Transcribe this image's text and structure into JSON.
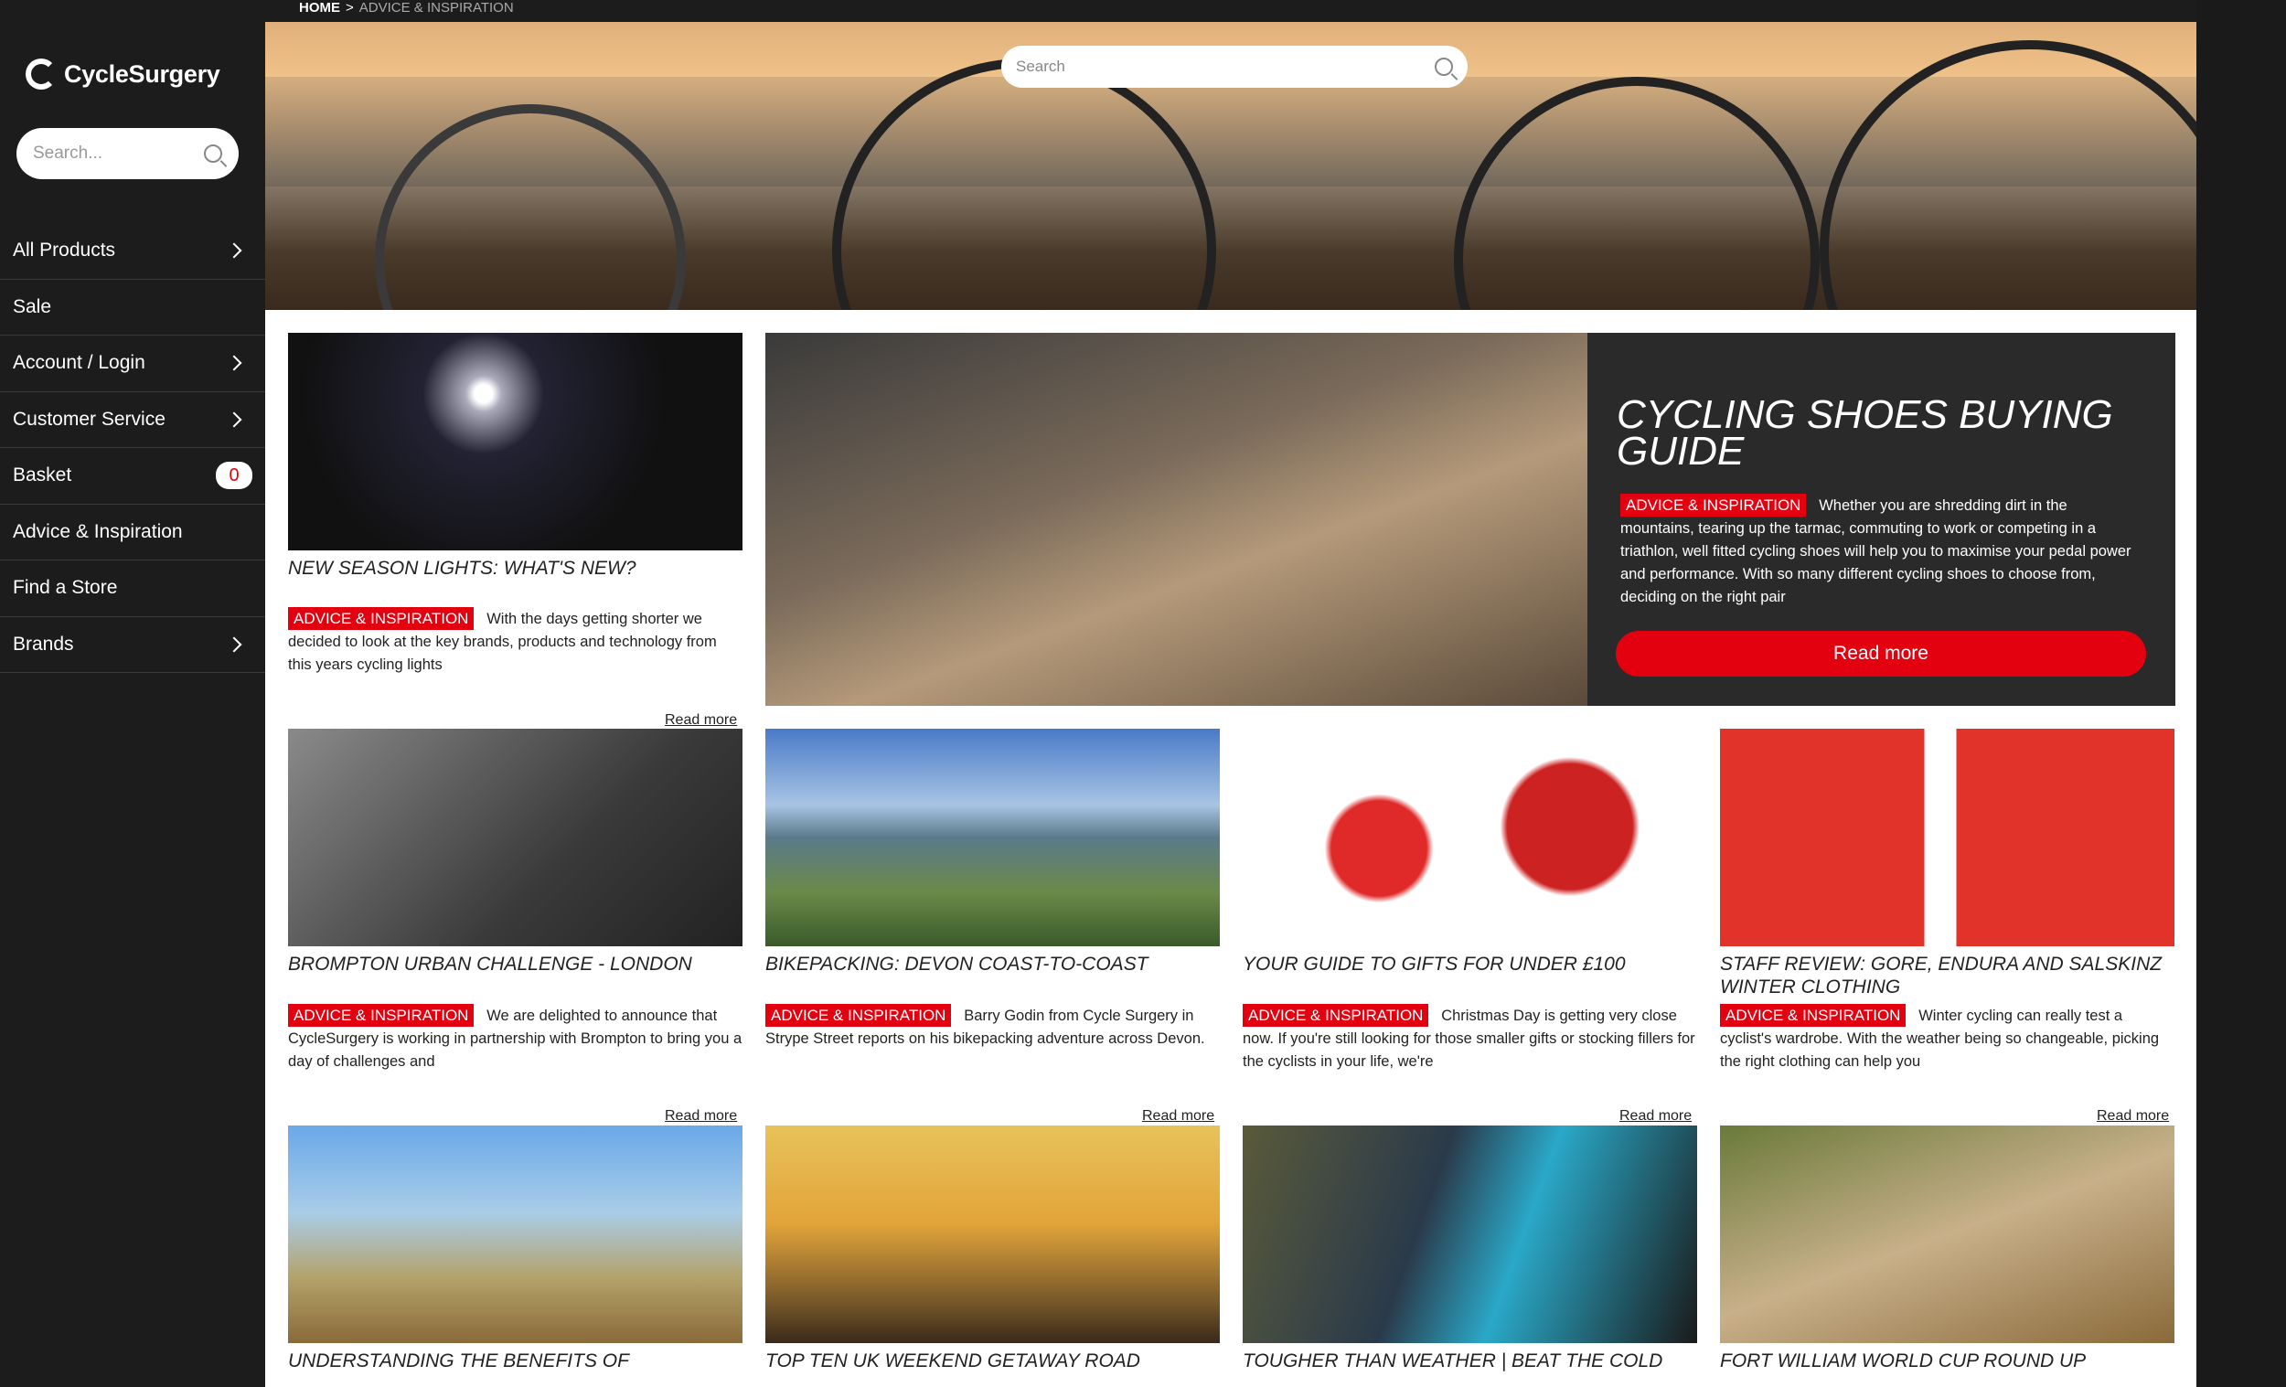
{
  "sidebar": {
    "logo_text": "CycleSurgery",
    "search_placeholder": "Search...",
    "items": [
      {
        "label": "All Products",
        "chevron": true
      },
      {
        "label": "Sale",
        "chevron": false
      },
      {
        "label": "Account / Login",
        "chevron": true
      },
      {
        "label": "Customer Service",
        "chevron": true
      },
      {
        "label": "Basket",
        "chevron": false,
        "badge": "0"
      },
      {
        "label": "Advice & Inspiration",
        "chevron": false
      },
      {
        "label": "Find a Store",
        "chevron": false
      },
      {
        "label": "Brands",
        "chevron": true
      }
    ]
  },
  "breadcrumb": {
    "home": "HOME",
    "sep": ">",
    "current": "ADVICE & INSPIRATION"
  },
  "hero": {
    "search_placeholder": "Search"
  },
  "feature": {
    "title": "CYCLING SHOES BUYING GUIDE",
    "tag": "ADVICE & INSPIRATION",
    "desc": "Whether you are shredding dirt in the mountains, tearing up the tarmac, commuting to work or competing in a triathlon, well fitted cycling shoes will help you to maximise your pedal power and performance. With so many different cycling shoes to choose from, deciding on the right pair",
    "button": "Read more"
  },
  "cards": [
    {
      "title": "NEW SEASON LIGHTS: WHAT'S NEW?",
      "tag": "ADVICE & INSPIRATION",
      "desc": "With the days getting shorter we decided to look at the key brands, products and technology from this years cycling lights",
      "read_more": "Read more"
    },
    {
      "title": "BROMPTON URBAN CHALLENGE - LONDON",
      "tag": "ADVICE & INSPIRATION",
      "desc": "We are delighted to announce that CycleSurgery is working in partnership with Brompton to bring you a day of challenges and",
      "read_more": "Read more"
    },
    {
      "title": "BIKEPACKING: DEVON COAST-TO-COAST",
      "tag": "ADVICE & INSPIRATION",
      "desc": "Barry Godin from Cycle Surgery in Strype Street reports on his bikepacking adventure across Devon.",
      "read_more": "Read more"
    },
    {
      "title": "YOUR GUIDE TO GIFTS FOR UNDER £100",
      "tag": "ADVICE & INSPIRATION",
      "desc": "Christmas Day is getting very close now. If you're still looking for those smaller gifts or stocking fillers for the cyclists in your life, we're",
      "read_more": "Read more"
    },
    {
      "title": "STAFF REVIEW:  GORE, ENDURA AND SALSKINZ WINTER CLOTHING",
      "tag": "ADVICE & INSPIRATION",
      "desc": "Winter cycling can really test a cyclist's wardrobe. With the weather being so changeable, picking the right clothing can help you",
      "read_more": "Read more"
    },
    {
      "title": "UNDERSTANDING THE BENEFITS OF"
    },
    {
      "title": "TOP TEN UK WEEKEND GETAWAY ROAD"
    },
    {
      "title": "TOUGHER THAN WEATHER | BEAT THE COLD"
    },
    {
      "title": "FORT WILLIAM WORLD CUP ROUND UP"
    }
  ],
  "colors": {
    "accent": "#e3000f",
    "sidebar_bg": "#1c1c1c",
    "feature_bg": "#2a2a2a"
  }
}
